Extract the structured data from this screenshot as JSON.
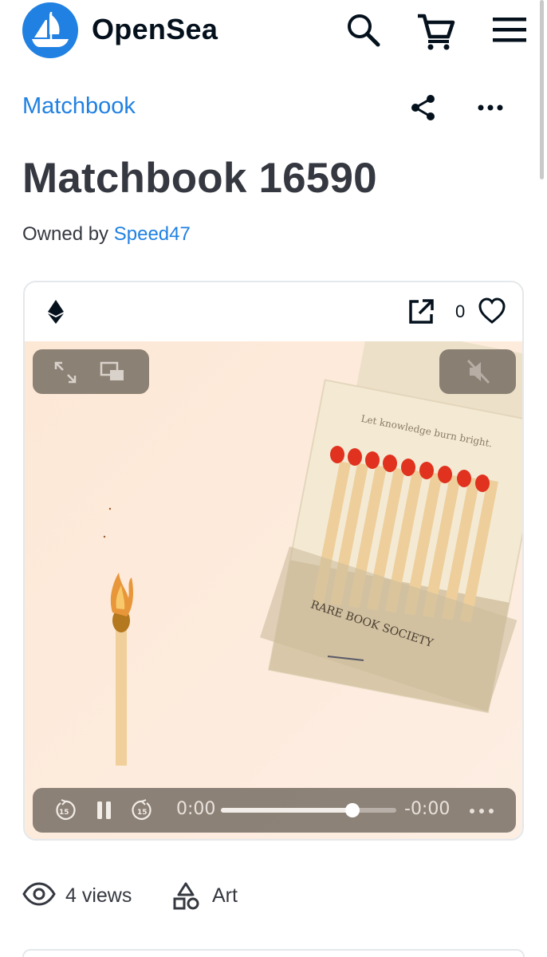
{
  "header": {
    "brand": "OpenSea",
    "icons": {
      "logo": "opensea-logo",
      "search": "search-icon",
      "cart": "cart-icon",
      "menu": "hamburger-menu-icon"
    }
  },
  "collection": {
    "name": "Matchbook",
    "icons": [
      "share-icon",
      "more-options-icon"
    ]
  },
  "item": {
    "title": "Matchbook 16590",
    "owned_by_label": "Owned by",
    "owner": "Speed47"
  },
  "card": {
    "chain_icon": "ethereum-icon",
    "favorite_count": "0",
    "artwork": {
      "tagline": "Let knowledge burn bright.",
      "brand_text": "RARE BOOK SOCIETY"
    },
    "player": {
      "current_time": "0:00",
      "remaining_time": "-0:00",
      "progress": 0.75,
      "icons": [
        "expand-icon",
        "picture-in-picture-icon",
        "mute-icon",
        "rewind-15-icon",
        "pause-icon",
        "forward-15-icon",
        "player-more-icon"
      ]
    }
  },
  "stats": {
    "views": "4 views",
    "category": "Art"
  },
  "colors": {
    "accent": "#2081e2",
    "text": "#353840",
    "media_bg": "#fdebdc",
    "match_head": "#e0321e"
  }
}
